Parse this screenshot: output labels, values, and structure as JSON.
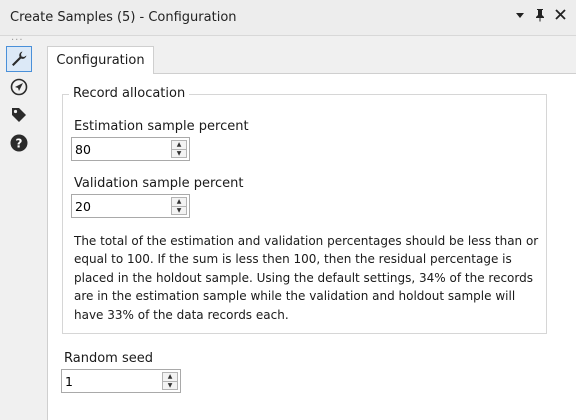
{
  "window": {
    "title": "Create Samples (5) - Configuration",
    "controls": {
      "menu": "▾",
      "pin": "📌",
      "close": "✕"
    }
  },
  "sidebar": {
    "items": [
      {
        "icon": "wrench-icon",
        "active": true
      },
      {
        "icon": "compass-icon",
        "active": false
      },
      {
        "icon": "tag-icon",
        "active": false
      },
      {
        "icon": "help-icon",
        "active": false
      }
    ]
  },
  "tab": {
    "label": "Configuration"
  },
  "record_allocation": {
    "legend": "Record allocation",
    "estimation": {
      "label": "Estimation sample percent",
      "value": "80"
    },
    "validation": {
      "label": "Validation sample percent",
      "value": "20"
    },
    "description": "The total of the estimation and validation percentages should be less than or equal to 100. If the sum is less then 100, then the residual percentage is placed in the holdout sample. Using the default settings, 34% of the records are in the estimation sample while the validation and holdout sample will have 33% of the data records each."
  },
  "random_seed": {
    "label": "Random seed",
    "value": "1"
  },
  "colors": {
    "accent": "#4a90d9",
    "panel": "#ffffff",
    "chrome": "#f0f0f0"
  }
}
